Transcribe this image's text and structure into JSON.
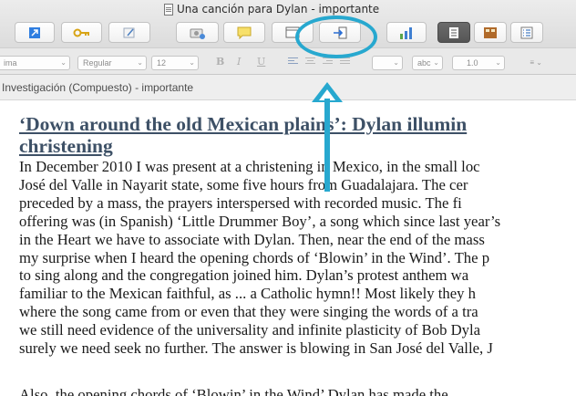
{
  "window": {
    "title": "Una canción para Dylan - importante"
  },
  "toolbar": {
    "buttons": [
      {
        "name": "go-to-button",
        "icon": "expand-arrow-icon"
      },
      {
        "name": "keywords-button",
        "icon": "key-icon"
      },
      {
        "name": "notes-button",
        "icon": "pencil-icon"
      },
      {
        "name": "snapshot-button",
        "icon": "camera-icon"
      },
      {
        "name": "comment-button",
        "icon": "speech-bubble-icon"
      },
      {
        "name": "quick-reference-button",
        "icon": "window-icon"
      },
      {
        "name": "compile-button",
        "icon": "import-arrow-icon"
      },
      {
        "name": "statistics-button",
        "icon": "bar-chart-icon"
      },
      {
        "name": "view-scrivenings-button",
        "icon": "stacked-docs-icon"
      },
      {
        "name": "view-corkboard-button",
        "icon": "corkboard-icon"
      },
      {
        "name": "view-outliner-button",
        "icon": "outline-list-icon"
      }
    ]
  },
  "formatbar": {
    "font_family": "ima",
    "font_style": "Regular",
    "font_size": "12",
    "bold": "B",
    "italic": "I",
    "underline": "U",
    "highlight_label": "abc",
    "line_spacing": "1.0"
  },
  "pathbar": {
    "text": "Investigación (Compuesto) - importante"
  },
  "document": {
    "heading_line1": "‘Down around the old Mexican plains’: Dylan illumin",
    "heading_line2": "christening",
    "paragraph_lines": [
      "In December 2010 I was present at a christening in Mexico, in the small loc",
      "José del Valle in Nayarit state, some five hours from Guadalajara. The cer",
      "preceded by a mass, the prayers interspersed with recorded music. The fi",
      "offering was (in Spanish) ‘Little Drummer Boy’, a song which since last year’s",
      "in the Heart we have to associate with Dylan. Then, near the end of the mass",
      "my surprise when I heard the opening chords of ‘Blowin’ in the Wind’. The p",
      "to sing along and the congregation joined him. Dylan’s protest anthem wa",
      "familiar to the Mexican faithful, as ... a Catholic hymn!! Most likely they h",
      "where the song came from or even that they were singing the words of a tra",
      "we still need evidence of the universality and infinite plasticity of Bob Dyla",
      "surely we need seek no further. The answer is blowing in San José del Valle, J"
    ],
    "second_paragraph_partial": "Also, the opening chords of ‘Blowin’ in the Wind’ Dylan has made the"
  },
  "annotation": {
    "color": "#27a8cf",
    "target": "compile-button"
  },
  "colors": {
    "heading": "#3d5066",
    "accent": "#27a8cf",
    "toolbar_bg": "#dcdcdc"
  }
}
